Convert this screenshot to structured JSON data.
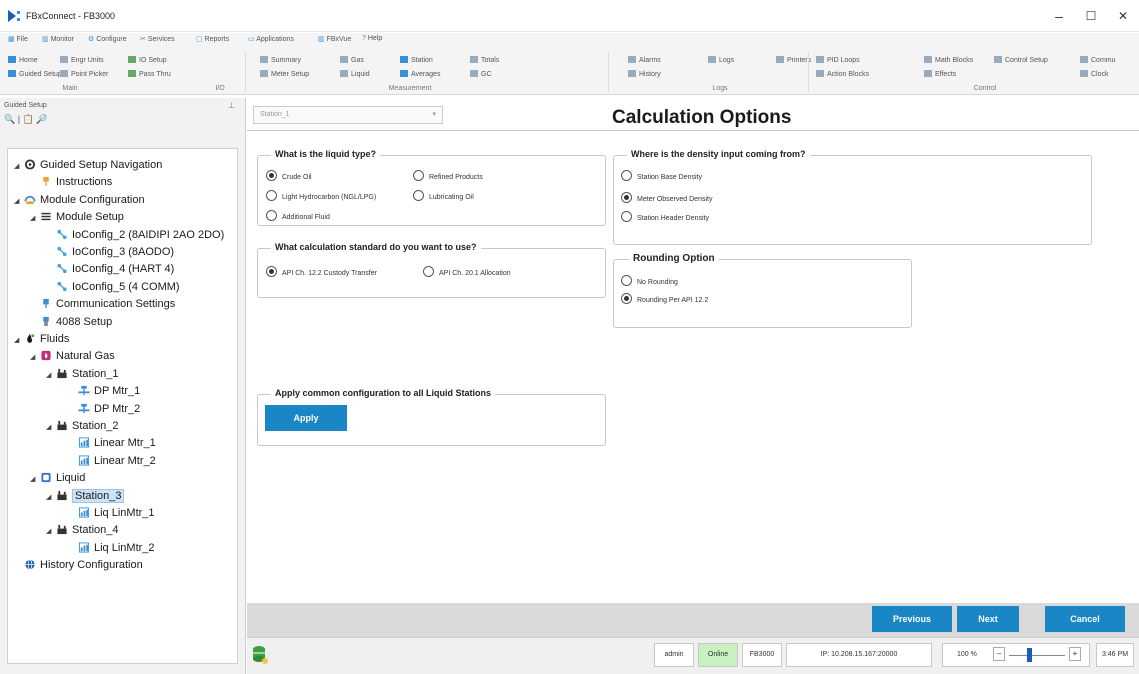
{
  "window": {
    "title": "FBxConnect - FB3000",
    "controls": {
      "minimize": "–",
      "maximize": "☐",
      "close": "✕"
    }
  },
  "menu": [
    "File",
    "Monitor",
    "Configure",
    "Services",
    "Reports",
    "Applications",
    "FBxVue",
    "Help"
  ],
  "ribbon": {
    "main": {
      "items": [
        "Home",
        "Guided Setup",
        "Engr Units",
        "Point Picker",
        "IO Setup",
        "Pass Thru"
      ],
      "label": "Main",
      "io_label": "I/O"
    },
    "measurement": {
      "items": [
        "Summary",
        "Meter Setup",
        "Gas",
        "Liquid",
        "Station",
        "Averages",
        "Totals",
        "GC"
      ],
      "label": "Measurement"
    },
    "logs": {
      "items": [
        "Alarms",
        "History",
        "Logs",
        "Printers"
      ],
      "label": "Logs"
    },
    "control": {
      "items": [
        "PID Loops",
        "Action Blocks",
        "Math Blocks",
        "Effects",
        "Control Setup",
        "Commu",
        "Clock"
      ],
      "label": "Control"
    }
  },
  "left_panel": {
    "title": "Guided Setup",
    "pin": "⊥",
    "toolbar": "🔍 | 📋 🔎",
    "tree": [
      {
        "label": "Guided Setup Navigation",
        "indent": 0,
        "expander": "◢",
        "icon": "gear-icon",
        "color": "#333333"
      },
      {
        "label": "Instructions",
        "indent": 1,
        "expander": "",
        "icon": "pin-icon",
        "color": "#e8a23a"
      },
      {
        "label": "Module Configuration",
        "indent": 0,
        "expander": "◢",
        "icon": "module-icon",
        "color": "#3a8fd6"
      },
      {
        "label": "Module Setup",
        "indent": 1,
        "expander": "◢",
        "icon": "list-icon",
        "color": "#333333"
      },
      {
        "label": "IoConfig_2 (8AIDIPI 2AO 2DO)",
        "indent": 2,
        "expander": "",
        "icon": "io-icon",
        "color": "#4aa3d8"
      },
      {
        "label": "IoConfig_3 (8AODO)",
        "indent": 2,
        "expander": "",
        "icon": "io-icon",
        "color": "#4aa3d8"
      },
      {
        "label": "IoConfig_4 (HART 4)",
        "indent": 2,
        "expander": "",
        "icon": "io-icon",
        "color": "#4aa3d8"
      },
      {
        "label": "IoConfig_5 (4 COMM)",
        "indent": 2,
        "expander": "",
        "icon": "io-icon",
        "color": "#4aa3d8"
      },
      {
        "label": "Communication Settings",
        "indent": 1,
        "expander": "",
        "icon": "comm-icon",
        "color": "#3a8fd6"
      },
      {
        "label": "4088 Setup",
        "indent": 1,
        "expander": "",
        "icon": "transmitter-icon",
        "color": "#3a8fd6"
      },
      {
        "label": "Fluids",
        "indent": 0,
        "expander": "◢",
        "icon": "fluids-icon",
        "color": "#1a1a1a"
      },
      {
        "label": "Natural Gas",
        "indent": 1,
        "expander": "◢",
        "icon": "gas-icon",
        "color": "#c0307a"
      },
      {
        "label": "Station_1",
        "indent": 2,
        "expander": "◢",
        "icon": "station-icon",
        "color": "#333333"
      },
      {
        "label": "DP Mtr_1",
        "indent": 3,
        "expander": "",
        "icon": "dp-meter-icon",
        "color": "#3a8fd6"
      },
      {
        "label": "DP Mtr_2",
        "indent": 3,
        "expander": "",
        "icon": "dp-meter-icon",
        "color": "#3a8fd6"
      },
      {
        "label": "Station_2",
        "indent": 2,
        "expander": "◢",
        "icon": "station-icon",
        "color": "#333333"
      },
      {
        "label": "Linear Mtr_1",
        "indent": 3,
        "expander": "",
        "icon": "linear-meter-icon",
        "color": "#3a8fd6"
      },
      {
        "label": "Linear Mtr_2",
        "indent": 3,
        "expander": "",
        "icon": "linear-meter-icon",
        "color": "#3a8fd6"
      },
      {
        "label": "Liquid",
        "indent": 1,
        "expander": "◢",
        "icon": "liquid-icon",
        "color": "#3a6fd6"
      },
      {
        "label": "Station_3",
        "indent": 2,
        "expander": "◢",
        "icon": "station-icon",
        "color": "#333333",
        "selected": true
      },
      {
        "label": "Liq LinMtr_1",
        "indent": 3,
        "expander": "",
        "icon": "linear-meter-icon",
        "color": "#3a8fd6"
      },
      {
        "label": "Station_4",
        "indent": 2,
        "expander": "◢",
        "icon": "station-icon",
        "color": "#333333"
      },
      {
        "label": "Liq LinMtr_2",
        "indent": 3,
        "expander": "",
        "icon": "linear-meter-icon",
        "color": "#3a8fd6"
      },
      {
        "label": "History Configuration",
        "indent": 0,
        "expander": "",
        "icon": "history-icon",
        "color": "#1a5fb4"
      }
    ]
  },
  "content": {
    "station_select": "Station_1",
    "title": "Calculation Options",
    "liquid_type": {
      "legend": "What is the liquid type?",
      "options": [
        "Crude Oil",
        "Refined Products",
        "Light Hydrocarbon (NGL/LPG)",
        "Lubricating Oil",
        "Additional Fluid"
      ],
      "selected": "Crude Oil"
    },
    "density": {
      "legend": "Where is the density input coming from?",
      "options": [
        "Station Base Density",
        "Meter Observed Density",
        "Station Header Density"
      ],
      "selected": "Meter Observed Density"
    },
    "standard": {
      "legend": "What calculation standard do you want to use?",
      "options": [
        "API Ch. 12.2 Custody Transfer",
        "API Ch. 20.1 Allocation"
      ],
      "selected": "API Ch. 12.2 Custody Transfer"
    },
    "rounding": {
      "legend": "Rounding Option",
      "options": [
        "No Rounding",
        "Rounding Per API 12.2"
      ],
      "selected": "Rounding Per API 12.2"
    },
    "apply_all": {
      "legend": "Apply common configuration to all Liquid Stations",
      "button": "Apply"
    }
  },
  "nav": {
    "previous": "Previous",
    "next": "Next",
    "cancel": "Cancel"
  },
  "status": {
    "user": "admin",
    "connection": "Online",
    "device": "FB3000",
    "ip": "IP: 10.208.15.167:20000",
    "zoom": "100 %",
    "zoom_minus": "–",
    "zoom_plus": "+",
    "zoom_level": 0.35,
    "time": "3:46 PM"
  },
  "colors": {
    "accent": "#1a86c6",
    "online": "#c8f0c0",
    "selection": "#cce3f7"
  }
}
